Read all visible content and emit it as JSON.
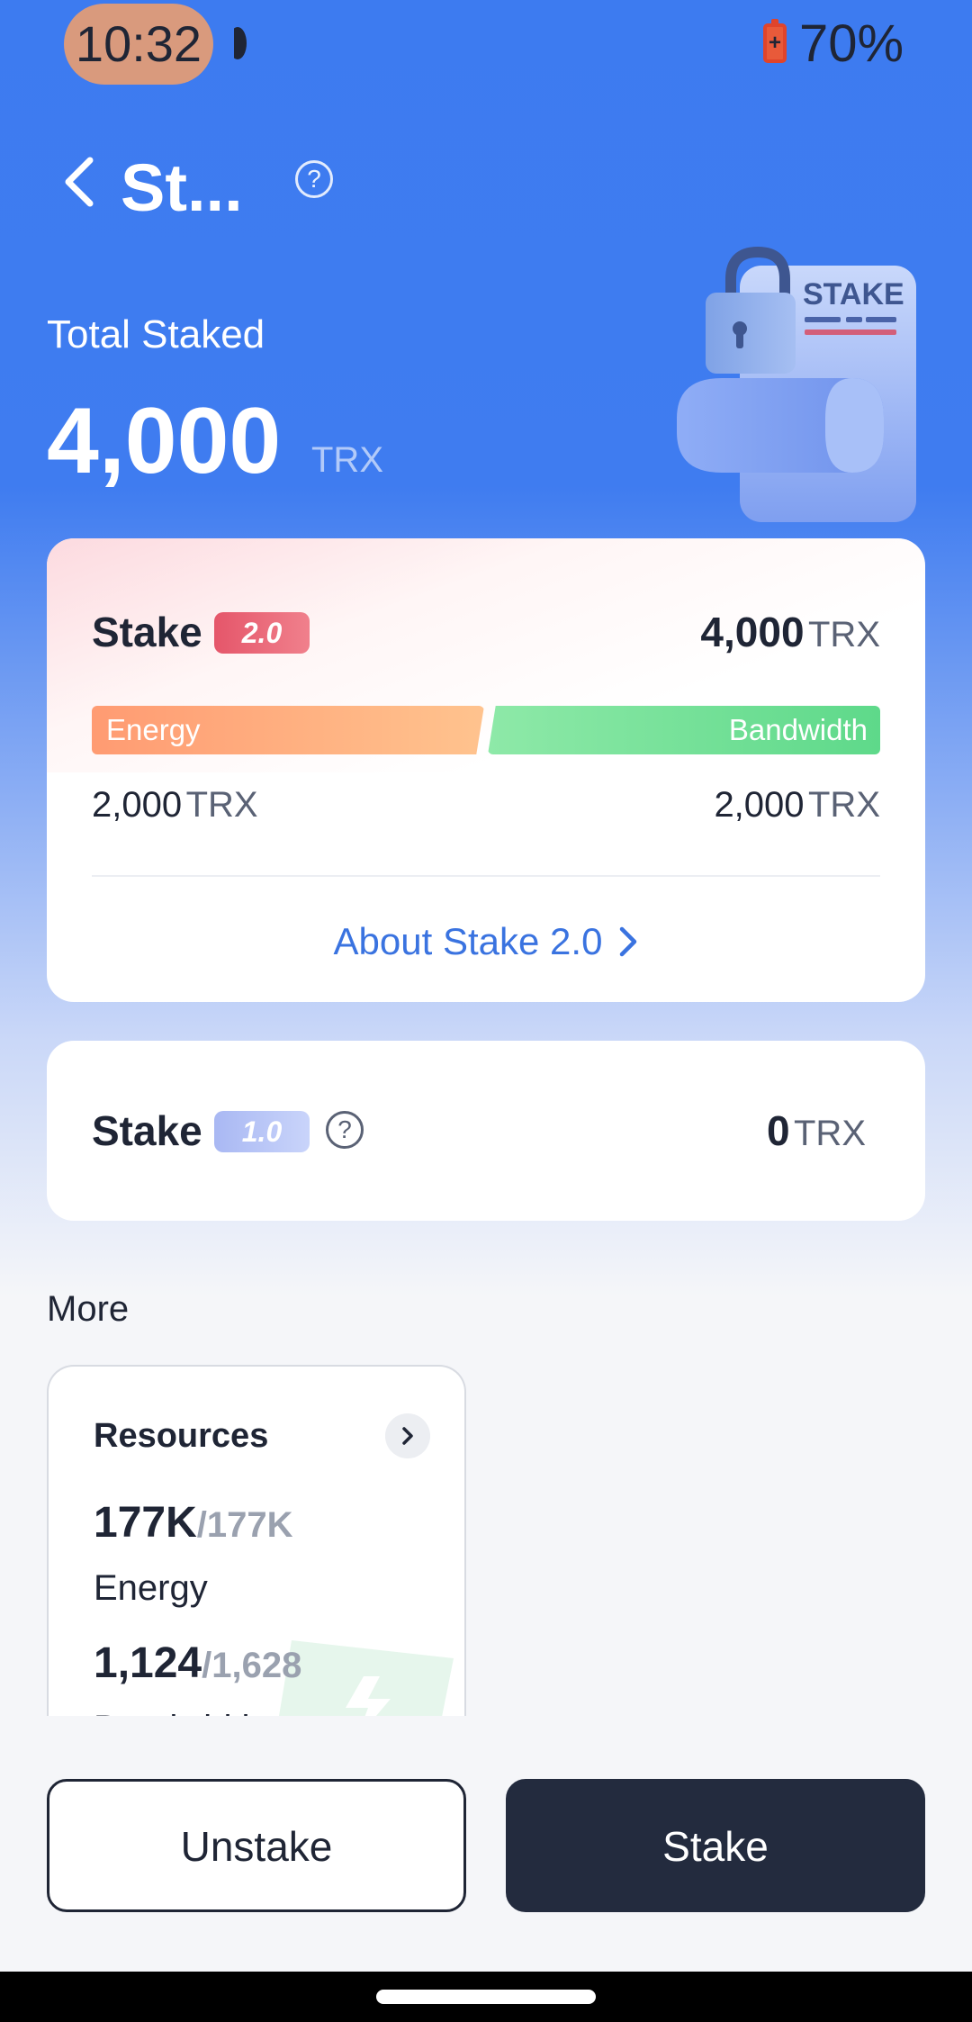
{
  "status_bar": {
    "time": "10:32",
    "battery_percent": "70%",
    "battery_level": 0.7
  },
  "header": {
    "title": "St...",
    "back_icon": "chevron-left-icon",
    "help_icon": "question-circle-icon"
  },
  "summary": {
    "label": "Total Staked",
    "value": "4,000",
    "unit": "TRX",
    "illustration_text": "STAKE"
  },
  "stake_v2": {
    "label": "Stake",
    "badge": "2.0",
    "total_value": "4,000",
    "total_unit": "TRX",
    "energy_label": "Energy",
    "bandwidth_label": "Bandwidth",
    "energy_value": "2,000",
    "energy_unit": "TRX",
    "bandwidth_value": "2,000",
    "bandwidth_unit": "TRX",
    "energy_share": 0.5,
    "about_link": "About Stake 2.0"
  },
  "stake_v1": {
    "label": "Stake",
    "badge": "1.0",
    "total_value": "0",
    "total_unit": "TRX"
  },
  "more": {
    "title": "More",
    "resources": {
      "title": "Resources",
      "energy_used": "177K",
      "energy_total": "/177K",
      "energy_label": "Energy",
      "bandwidth_used": "1,124",
      "bandwidth_total": "/1,628",
      "bandwidth_label": "Bandwidth"
    }
  },
  "actions": {
    "unstake": "Unstake",
    "stake": "Stake"
  },
  "colors": {
    "primary_blue": "#3d7bf0",
    "energy": "#ff9b72",
    "bandwidth": "#5ed98a",
    "badge_v2": "#e5566a",
    "badge_v1": "#a9b8f3",
    "dark_button": "#232b3e",
    "link": "#3a73e0"
  }
}
